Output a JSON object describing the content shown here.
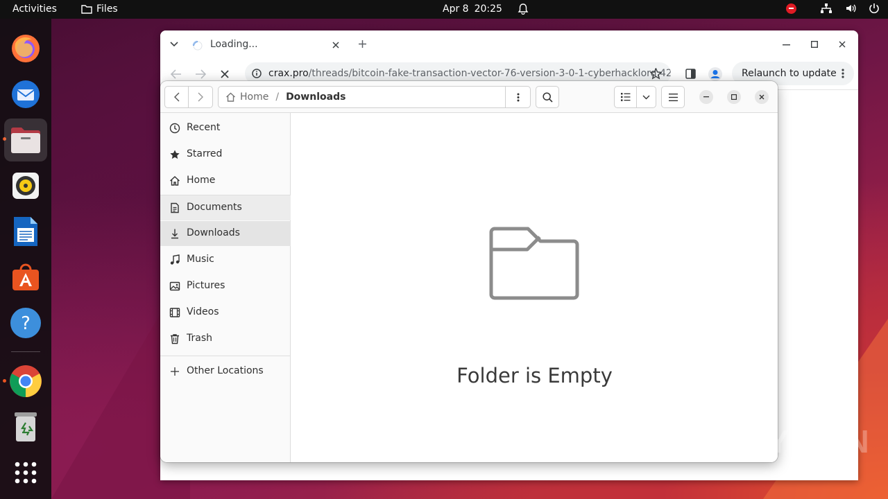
{
  "topbar": {
    "activities": "Activities",
    "app_name": "Files",
    "date": "Apr 8",
    "time": "20:25"
  },
  "dock": {
    "items": [
      {
        "name": "Firefox",
        "icon": "firefox-icon"
      },
      {
        "name": "Thunderbird",
        "icon": "thunderbird-icon"
      },
      {
        "name": "Files",
        "icon": "files-icon",
        "active": true
      },
      {
        "name": "Rhythmbox",
        "icon": "rhythmbox-icon"
      },
      {
        "name": "LibreOffice Writer",
        "icon": "writer-icon"
      },
      {
        "name": "Ubuntu Software",
        "icon": "software-icon"
      },
      {
        "name": "Help",
        "icon": "help-icon"
      },
      {
        "name": "Google Chrome",
        "icon": "chrome-icon",
        "running": true
      },
      {
        "name": "Trash",
        "icon": "trash-icon"
      },
      {
        "name": "Show Applications",
        "icon": "app-grid-icon"
      }
    ]
  },
  "chrome": {
    "tab_title": "Loading...",
    "url_host": "crax.pro",
    "url_path": "/threads/bitcoin-fake-transaction-vector-76-version-3-0-1-cyberhacklord.427…",
    "relaunch_label": "Relaunch to update"
  },
  "files": {
    "breadcrumb_home": "Home",
    "breadcrumb_current": "Downloads",
    "empty_message": "Folder is Empty",
    "sidebar": [
      {
        "label": "Recent",
        "icon": "clock-icon"
      },
      {
        "label": "Starred",
        "icon": "star-icon"
      },
      {
        "label": "Home",
        "icon": "home-icon"
      },
      {
        "label": "Documents",
        "icon": "document-icon"
      },
      {
        "label": "Downloads",
        "icon": "download-icon",
        "selected": true
      },
      {
        "label": "Music",
        "icon": "music-icon"
      },
      {
        "label": "Pictures",
        "icon": "picture-icon"
      },
      {
        "label": "Videos",
        "icon": "video-icon"
      },
      {
        "label": "Trash",
        "icon": "trash-icon"
      },
      {
        "label": "Other Locations",
        "icon": "plus-icon"
      }
    ]
  },
  "watermark": "ANY RUN",
  "colors": {
    "topbar": "#111111",
    "accent_orange": "#e95420",
    "selected_row": "#e4e4e4"
  }
}
